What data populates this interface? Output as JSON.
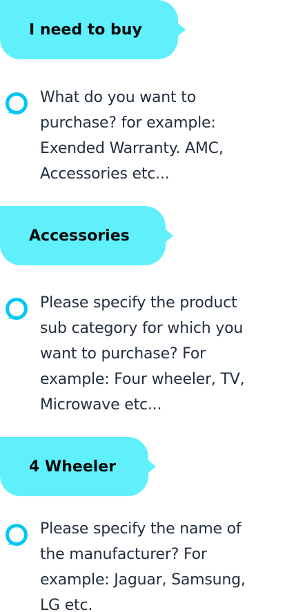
{
  "colors": {
    "bubble": "#5ff0fc",
    "text": "#232f3e",
    "alexa_ring": "#00c7f5"
  },
  "conversation": [
    {
      "role": "user",
      "text": "I need to buy"
    },
    {
      "role": "alexa",
      "icon": "alexa-ring-icon",
      "text": "What do you want to\npurchase? for example:\nExended Warranty. AMC,\nAccessories etc..."
    },
    {
      "role": "user",
      "text": "Accessories"
    },
    {
      "role": "alexa",
      "icon": "alexa-ring-icon",
      "text": "Please specify the product\nsub category for which you\nwant to purchase? For\nexample: Four wheeler, TV,\nMicrowave etc..."
    },
    {
      "role": "user",
      "text": "4 Wheeler"
    },
    {
      "role": "alexa",
      "icon": "alexa-ring-icon",
      "text": "Please specify the name of\nthe manufacturer? For\nexample: Jaguar, Samsung,\nLG etc."
    }
  ]
}
